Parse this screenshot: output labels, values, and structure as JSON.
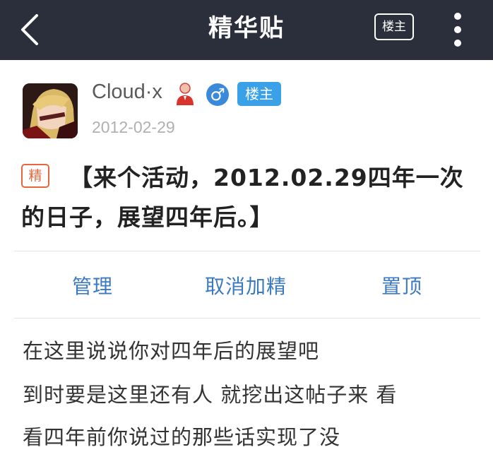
{
  "header": {
    "title": "精华贴",
    "op_button_label": "楼主"
  },
  "post": {
    "author": {
      "name": "Cloud·x",
      "op_badge": "楼主",
      "gender_symbol": "♂"
    },
    "date": "2012-02-29",
    "featured_tag": "精",
    "title": "【来个活动，2012.02.29四年一次的日子，展望四年后。】",
    "actions": {
      "manage": "管理",
      "unfeature": "取消加精",
      "pin": "置顶"
    },
    "body_lines": [
      "在这里说说你对四年后的展望吧",
      "到时要是这里还有人 就挖出这帖子来 看",
      "看四年前你说过的那些话实现了没"
    ]
  },
  "colors": {
    "topbar": "#2a2f3b",
    "link": "#3b79c4",
    "featured": "#e8663c",
    "badge": "#3aa1e8"
  }
}
